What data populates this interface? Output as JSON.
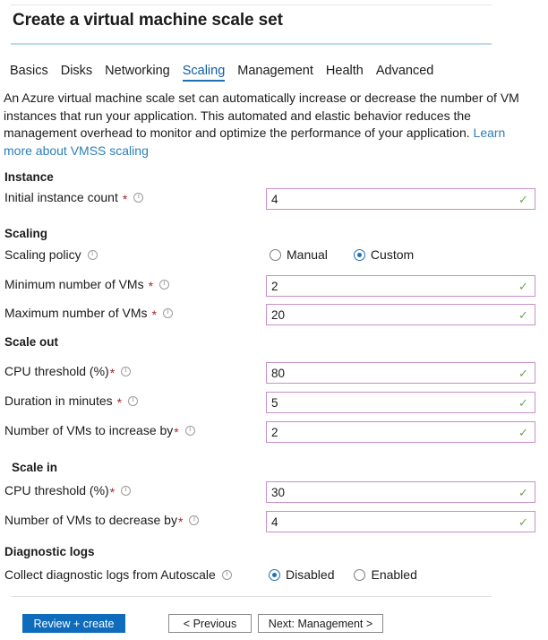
{
  "header": {
    "title": "Create a virtual machine scale set"
  },
  "tabs": [
    {
      "label": "Basics",
      "active": false
    },
    {
      "label": "Disks",
      "active": false
    },
    {
      "label": "Networking",
      "active": false
    },
    {
      "label": "Scaling",
      "active": true
    },
    {
      "label": "Management",
      "active": false
    },
    {
      "label": "Health",
      "active": false
    },
    {
      "label": "Advanced",
      "active": false
    }
  ],
  "description": {
    "body": "An Azure virtual machine scale set can automatically increase or decrease the number of VM instances that run your application. This automated and elastic behavior reduces the management overhead to monitor and optimize the performance of your application. ",
    "link": "Learn more about VMSS scaling"
  },
  "sections": {
    "instance": "Instance",
    "scaling": "Scaling",
    "scale_out": "Scale out",
    "scale_in": "Scale in",
    "diagnostic_logs": "Diagnostic logs"
  },
  "fields": {
    "initial_instance_count": {
      "label": "Initial instance count",
      "value": "4",
      "required": true,
      "valid": true
    },
    "minimum_vms": {
      "label": "Minimum number of VMs",
      "value": "2",
      "required": true,
      "valid": true
    },
    "maximum_vms": {
      "label": "Maximum number of VMs",
      "value": "20",
      "required": true,
      "valid": true
    },
    "out_cpu_threshold": {
      "label": "CPU threshold (%)",
      "value": "80",
      "required": true,
      "valid": true
    },
    "out_duration": {
      "label": "Duration in minutes",
      "value": "5",
      "required": true,
      "valid": true
    },
    "out_increase_by": {
      "label": "Number of VMs to increase by",
      "value": "2",
      "required": true,
      "valid": true
    },
    "in_cpu_threshold": {
      "label": "CPU threshold (%)",
      "value": "30",
      "required": true,
      "valid": true
    },
    "in_decrease_by": {
      "label": "Number of VMs to decrease by",
      "value": "4",
      "required": true,
      "valid": true
    }
  },
  "scaling_policy": {
    "label": "Scaling policy",
    "options": [
      {
        "label": "Manual",
        "selected": false
      },
      {
        "label": "Custom",
        "selected": true
      }
    ]
  },
  "collect_logs": {
    "label": "Collect diagnostic logs from Autoscale",
    "options": [
      {
        "label": "Disabled",
        "selected": true
      },
      {
        "label": "Enabled",
        "selected": false
      }
    ]
  },
  "footer": {
    "review_create": "Review + create",
    "previous": "< Previous",
    "next": "Next: Management >"
  },
  "icons": {
    "info": "info-icon",
    "valid": "checkmark-icon"
  },
  "colors": {
    "accent_blue": "#0f6cbd",
    "tab_underline": "#1f6fb5",
    "title_rule": "#b8dcea",
    "field_border": "#c88fc8",
    "valid_check": "#6aa84f",
    "required_asterisk": "#a4262c",
    "link": "#2d7eb9"
  }
}
